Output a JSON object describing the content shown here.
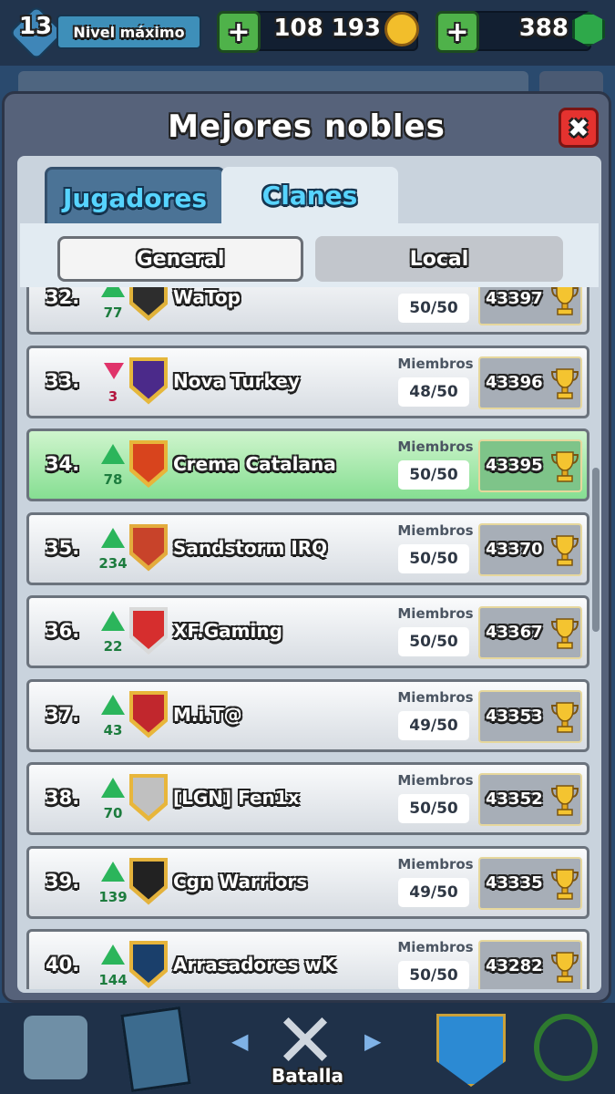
{
  "topbar": {
    "level": "13",
    "level_label": "Nivel máximo",
    "gold": "108 193",
    "gems": "388",
    "plus_symbol": "+",
    "coin_icon": "coin-icon",
    "gem_icon": "gem-icon"
  },
  "modal": {
    "title": "Mejores nobles",
    "close_symbol": "✖",
    "tabs": [
      "Jugadores",
      "Clanes"
    ],
    "subtabs": [
      "General",
      "Local"
    ],
    "members_label": "Miembros"
  },
  "clans": [
    {
      "rank": "32.",
      "direction": "up",
      "delta": "77",
      "name": "WaTop",
      "members": "50/50",
      "trophies": "43397",
      "badge_color": "#e0b23a",
      "badge_inner": "#2d2d2d"
    },
    {
      "rank": "33.",
      "direction": "down",
      "delta": "3",
      "name": "Nova Turkey",
      "members": "48/50",
      "trophies": "43396",
      "badge_color": "#e5b73b",
      "badge_inner": "#4b2a8a"
    },
    {
      "rank": "34.",
      "direction": "up",
      "delta": "78",
      "name": "Crema Catalana",
      "members": "50/50",
      "trophies": "43395",
      "badge_color": "#e7b53a",
      "badge_inner": "#d8441d",
      "highlight": true
    },
    {
      "rank": "35.",
      "direction": "up",
      "delta": "234",
      "name": "Sandstorm IRQ",
      "members": "50/50",
      "trophies": "43370",
      "badge_color": "#e3ac3d",
      "badge_inner": "#c8432a"
    },
    {
      "rank": "36.",
      "direction": "up",
      "delta": "22",
      "name": "XF.Gaming",
      "members": "50/50",
      "trophies": "43367",
      "badge_color": "#d9d9d9",
      "badge_inner": "#d62e2e"
    },
    {
      "rank": "37.",
      "direction": "up",
      "delta": "43",
      "name": "M.i.T@",
      "members": "49/50",
      "trophies": "43353",
      "badge_color": "#e8b63b",
      "badge_inner": "#c1272d"
    },
    {
      "rank": "38.",
      "direction": "up",
      "delta": "70",
      "name": "[LGN] Fen1x",
      "members": "50/50",
      "trophies": "43352",
      "badge_color": "#e8b63b",
      "badge_inner": "#c0c0c0"
    },
    {
      "rank": "39.",
      "direction": "up",
      "delta": "139",
      "name": "Cgn Warriors",
      "members": "49/50",
      "trophies": "43335",
      "badge_color": "#e3b23c",
      "badge_inner": "#222222"
    },
    {
      "rank": "40.",
      "direction": "up",
      "delta": "144",
      "name": "Arrasadores wK",
      "members": "50/50",
      "trophies": "43282",
      "badge_color": "#e6b43b",
      "badge_inner": "#1a3f6b"
    }
  ],
  "bottomnav": {
    "active_label": "Batalla"
  }
}
